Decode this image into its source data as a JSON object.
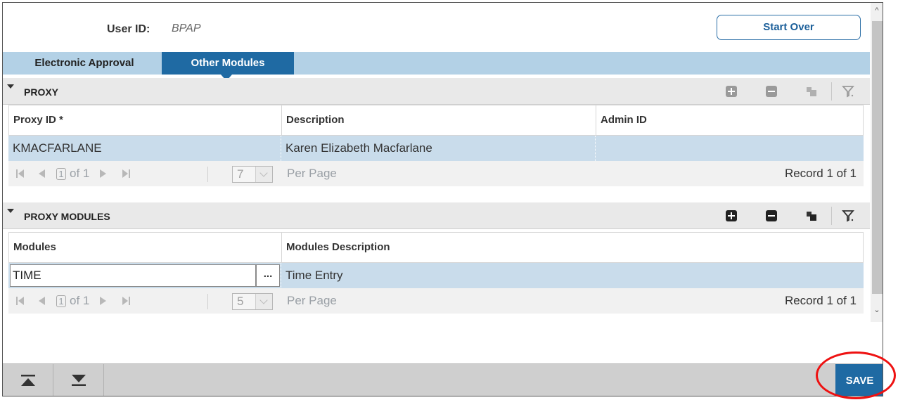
{
  "header": {
    "user_id_label": "User ID:",
    "user_id_value": "BPAP",
    "start_over_label": "Start Over"
  },
  "tabs": [
    {
      "label": "Electronic Approval",
      "active": false
    },
    {
      "label": "Other Modules",
      "active": true
    }
  ],
  "proxy": {
    "title": "PROXY",
    "columns": [
      "Proxy ID *",
      "Description",
      "Admin ID"
    ],
    "rows": [
      {
        "proxy_id": "KMACFARLANE",
        "description": "Karen Elizabeth Macfarlane",
        "admin_id": ""
      }
    ],
    "pager": {
      "page": "1",
      "of_label": "of 1",
      "per_page_value": "7",
      "per_page_label": "Per Page",
      "record_label": "Record 1 of 1"
    }
  },
  "proxy_modules": {
    "title": "PROXY MODULES",
    "columns": [
      "Modules",
      "Modules Description"
    ],
    "rows": [
      {
        "module": "TIME",
        "lookup": "...",
        "description": "Time Entry"
      }
    ],
    "pager": {
      "page": "1",
      "of_label": "of 1",
      "per_page_value": "5",
      "per_page_label": "Per Page",
      "record_label": "Record 1 of 1"
    }
  },
  "toolbar_icons": [
    "insert-icon",
    "delete-icon",
    "copy-icon",
    "filter-icon"
  ],
  "footer": {
    "save_label": "SAVE"
  },
  "colors": {
    "accent": "#1f6aa3",
    "tab_bar": "#b3d1e6",
    "selected_row": "#c9dceb",
    "annotation": "#e11111"
  }
}
